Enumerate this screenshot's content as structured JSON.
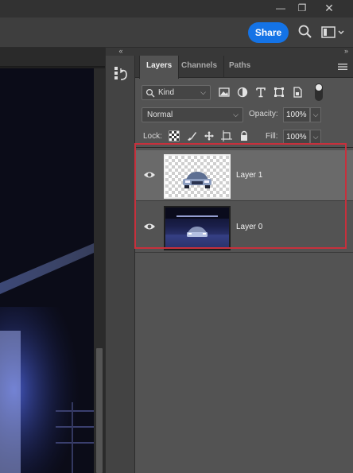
{
  "titlebar": {
    "minimize_glyph": "—",
    "restore_glyph": "❐",
    "close_glyph": "✕"
  },
  "optionsbar": {
    "share_label": "Share"
  },
  "layers_panel": {
    "tabs": [
      {
        "label": "Layers",
        "active": true
      },
      {
        "label": "Channels",
        "active": false
      },
      {
        "label": "Paths",
        "active": false
      }
    ],
    "filter": {
      "label": "Kind"
    },
    "blend_mode": "Normal",
    "opacity_label": "Opacity:",
    "opacity_value": "100%",
    "lock_label": "Lock:",
    "fill_label": "Fill:",
    "fill_value": "100%",
    "layers": [
      {
        "name": "Layer 1",
        "visible": true,
        "selected": true
      },
      {
        "name": "Layer 0",
        "visible": true,
        "selected": false
      }
    ],
    "highlight_color": "#c7303c"
  },
  "colors": {
    "accent": "#1473e6",
    "panel_bg": "#535353",
    "selected_row": "#6a6a6a"
  }
}
